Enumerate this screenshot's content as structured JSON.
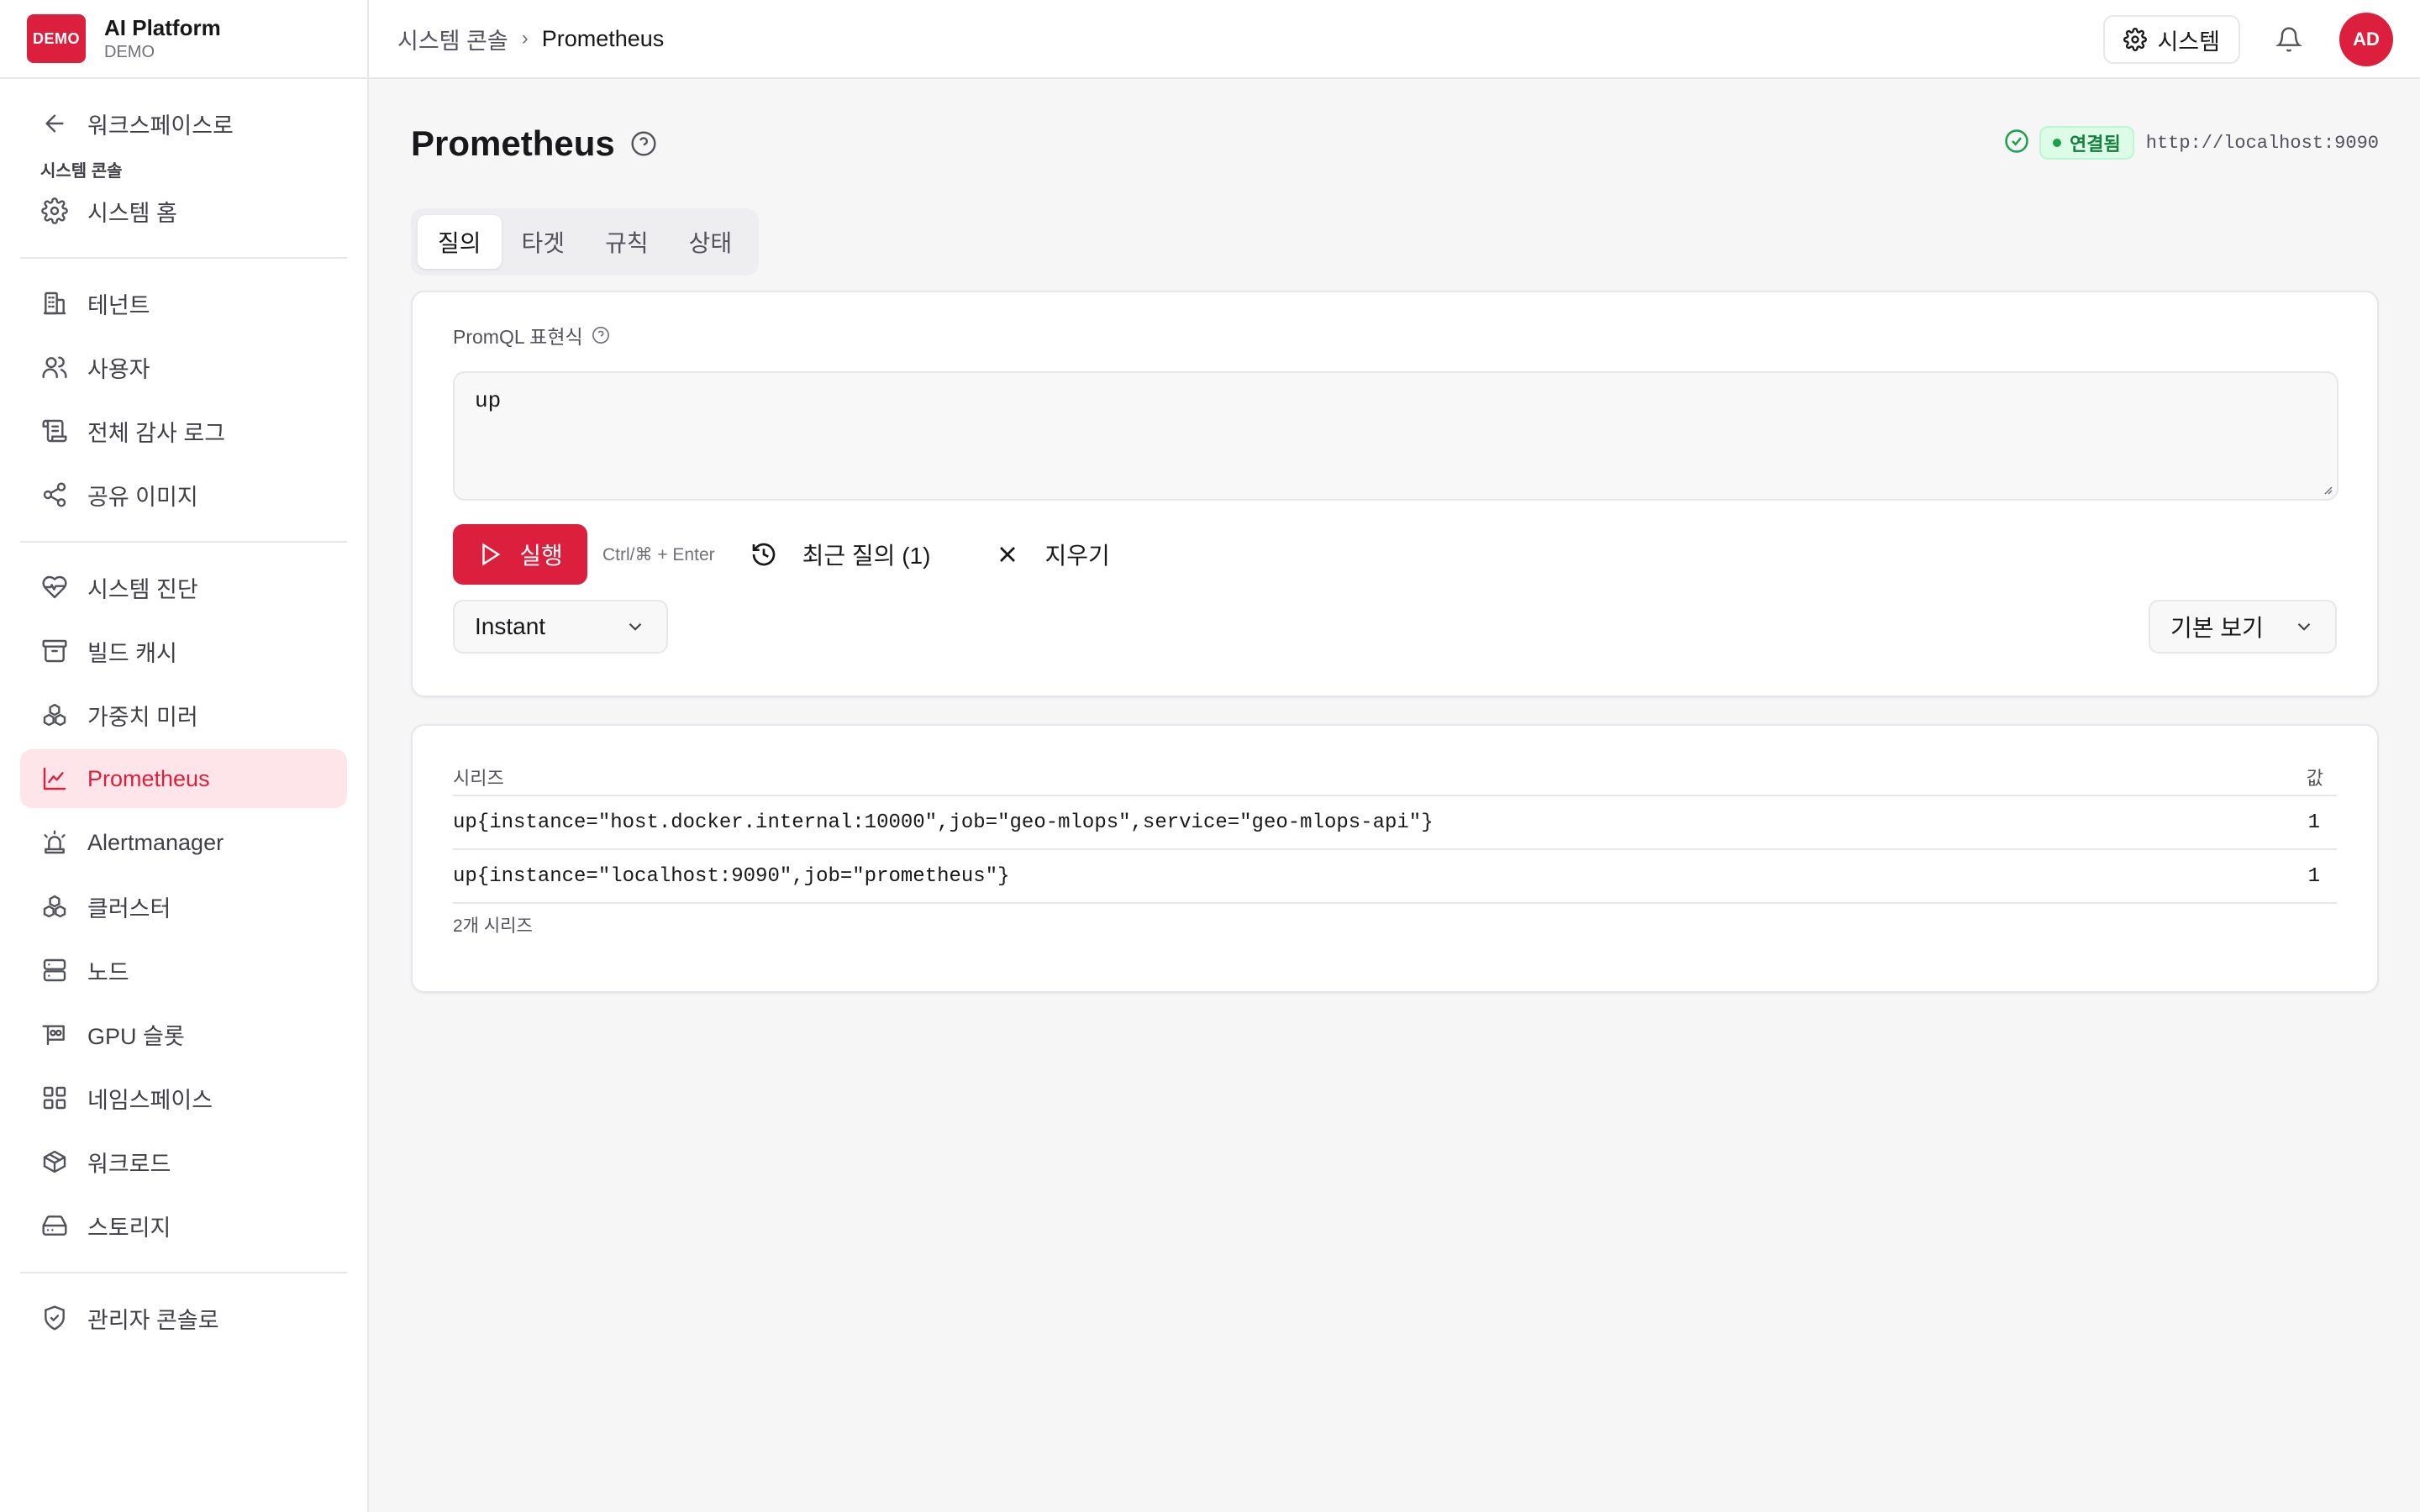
{
  "brand": {
    "logo": "DEMO",
    "name": "AI Platform",
    "sub": "DEMO"
  },
  "sidebar": {
    "back": {
      "label": "워크스페이스로",
      "icon": "arrow-left-icon"
    },
    "section_label": "시스템 콘솔",
    "home": {
      "label": "시스템 홈",
      "icon": "gear-icon"
    },
    "group1": [
      {
        "label": "테넌트",
        "icon": "building-icon"
      },
      {
        "label": "사용자",
        "icon": "users-icon"
      },
      {
        "label": "전체 감사 로그",
        "icon": "scroll-icon"
      },
      {
        "label": "공유 이미지",
        "icon": "share-icon"
      }
    ],
    "group2": [
      {
        "label": "시스템 진단",
        "icon": "heart-pulse-icon"
      },
      {
        "label": "빌드 캐시",
        "icon": "archive-icon"
      },
      {
        "label": "가중치 미러",
        "icon": "boxes-icon"
      },
      {
        "label": "Prometheus",
        "icon": "line-chart-icon",
        "active": true
      },
      {
        "label": "Alertmanager",
        "icon": "siren-icon"
      },
      {
        "label": "클러스터",
        "icon": "boxes-icon"
      },
      {
        "label": "노드",
        "icon": "server-icon"
      },
      {
        "label": "GPU 슬롯",
        "icon": "gpu-icon"
      },
      {
        "label": "네임스페이스",
        "icon": "grid-icon"
      },
      {
        "label": "워크로드",
        "icon": "package-icon"
      },
      {
        "label": "스토리지",
        "icon": "hard-drive-icon"
      }
    ],
    "admin": {
      "label": "관리자 콘솔로",
      "icon": "shield-check-icon"
    }
  },
  "header": {
    "breadcrumb": [
      "시스템 콘솔",
      "Prometheus"
    ],
    "system_button": "시스템",
    "avatar": "AD"
  },
  "page": {
    "title": "Prometheus",
    "status": "연결됨",
    "url": "http://localhost:9090",
    "tabs": [
      "질의",
      "타겟",
      "규칙",
      "상태"
    ],
    "active_tab": "질의"
  },
  "query": {
    "label": "PromQL 표현식",
    "value": "up",
    "run_label": "실행",
    "shortcut": "Ctrl/⌘ + Enter",
    "recent_label": "최근 질의 (1)",
    "clear_label": "지우기",
    "mode": "Instant",
    "view": "기본 보기"
  },
  "results": {
    "col_series": "시리즈",
    "col_value": "값",
    "rows": [
      {
        "series": "up{instance=\"host.docker.internal:10000\",job=\"geo-mlops\",service=\"geo-mlops-api\"}",
        "value": "1"
      },
      {
        "series": "up{instance=\"localhost:9090\",job=\"prometheus\"}",
        "value": "1"
      }
    ],
    "count": "2개 시리즈"
  },
  "colors": {
    "accent": "#dc1f3c",
    "success": "#16a34a",
    "active_bg": "#fde5e9"
  }
}
